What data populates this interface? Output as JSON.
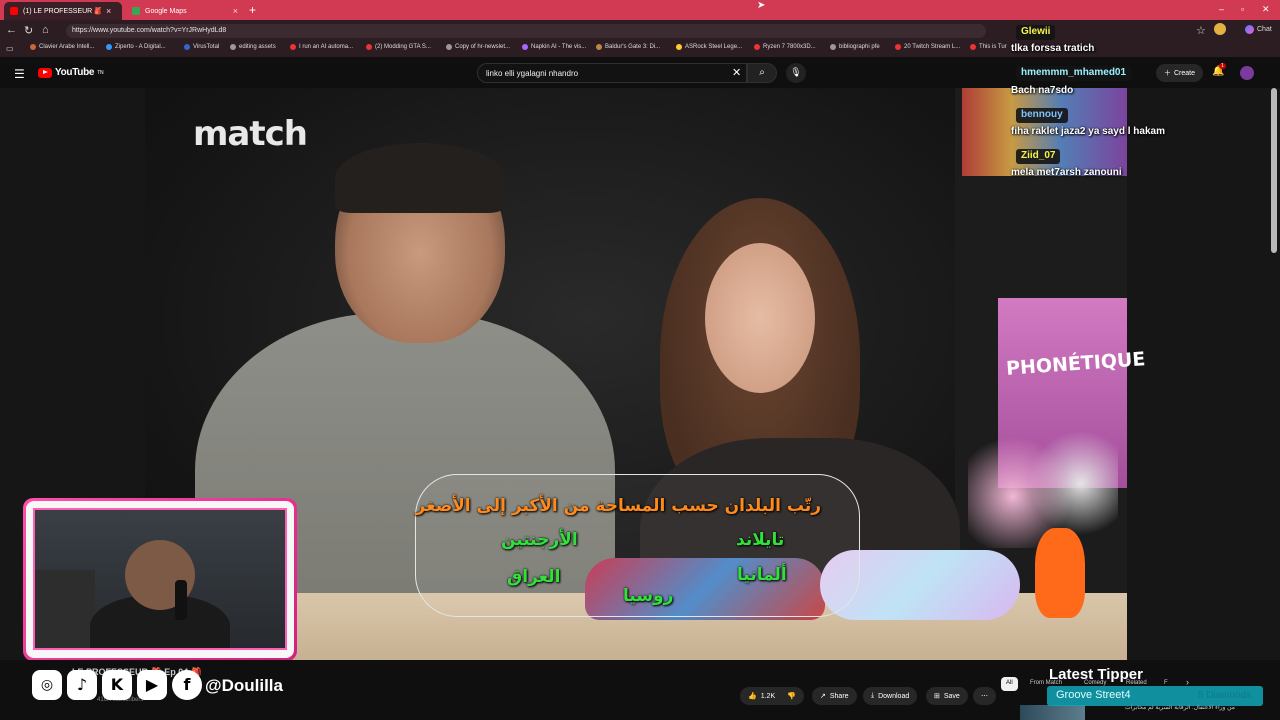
{
  "browser": {
    "tabs": [
      {
        "label": "(1) LE PROFESSEUR 🎒 Ep 04",
        "active": true,
        "favicon_color": "#ff0000"
      },
      {
        "label": "Google Maps",
        "active": false,
        "favicon_color": "#34a853"
      }
    ],
    "new_tab_icon": "+",
    "url": "https://www.youtube.com/watch?v=YrJRwHydLd8",
    "bookmarks": [
      "Clavier Arabe Intell...",
      "Ziperto - A Digital...",
      "VirusTotal",
      "editing assets",
      "I run an AI automa...",
      "(2) Modding GTA S...",
      "Copy of hr-newslet...",
      "Napkin AI - The vis...",
      "Baldur's Gate 3: Di...",
      "ASRock Steel Lege...",
      "Ryzen 7 7800x3D...",
      "bibliographi pfe",
      "20 Twitch Stream L...",
      "This is Tur"
    ],
    "chat_button": "Chat"
  },
  "youtube": {
    "logo_text": "YouTube",
    "logo_sup": "TN",
    "search_value": "linko  elli ygalagni nhandro",
    "create_label": "Create",
    "notification_count": "1"
  },
  "video": {
    "watermark": "match",
    "quiz": {
      "title": "رتّب البلدان حسب المساحة من الأكبر إلى الأصغر",
      "options": [
        "تايلاند",
        "الأرجنتين",
        "ألمانيا",
        "العراق",
        "روسيا"
      ]
    }
  },
  "below_video": {
    "channel_title": "LE PROFESSEUR 🎒 Ep 04 🎒",
    "subscribers": "416K subscribers",
    "likes": "1.2K",
    "share": "Share",
    "download": "Download",
    "save": "Save",
    "chips": [
      "All",
      "From Match",
      "Comedy",
      "Related",
      "F"
    ],
    "up_next": "من وراء الاعتقال: الرقابة السرية لم مخابرات"
  },
  "streamer_overlay": {
    "social_handle": "@Doulilla",
    "social_icons": [
      "instagram-icon",
      "tiktok-icon",
      "kick-icon",
      "youtube-icon",
      "facebook-icon"
    ],
    "latest_tipper_label": "Latest Tipper",
    "tipper_name": "Groove Street4",
    "tipper_amount": "5 Diamonds",
    "frame_color": "#ff4fa8"
  },
  "chat": [
    {
      "user": "Glewii",
      "color": "#f5f34a",
      "message": "tlka forssa tratich"
    },
    {
      "user": "hmemmm_mhamed01",
      "color": "#9bf0ff",
      "message": "Bach na7sdo"
    },
    {
      "user": "bennouy",
      "color": "#7fc4ff",
      "message": "fiha raklet jaza2 ya sayd l hakam"
    },
    {
      "user": "Ziid_07",
      "color": "#f5f34a",
      "message": "mela met7arsh zanouni"
    }
  ]
}
